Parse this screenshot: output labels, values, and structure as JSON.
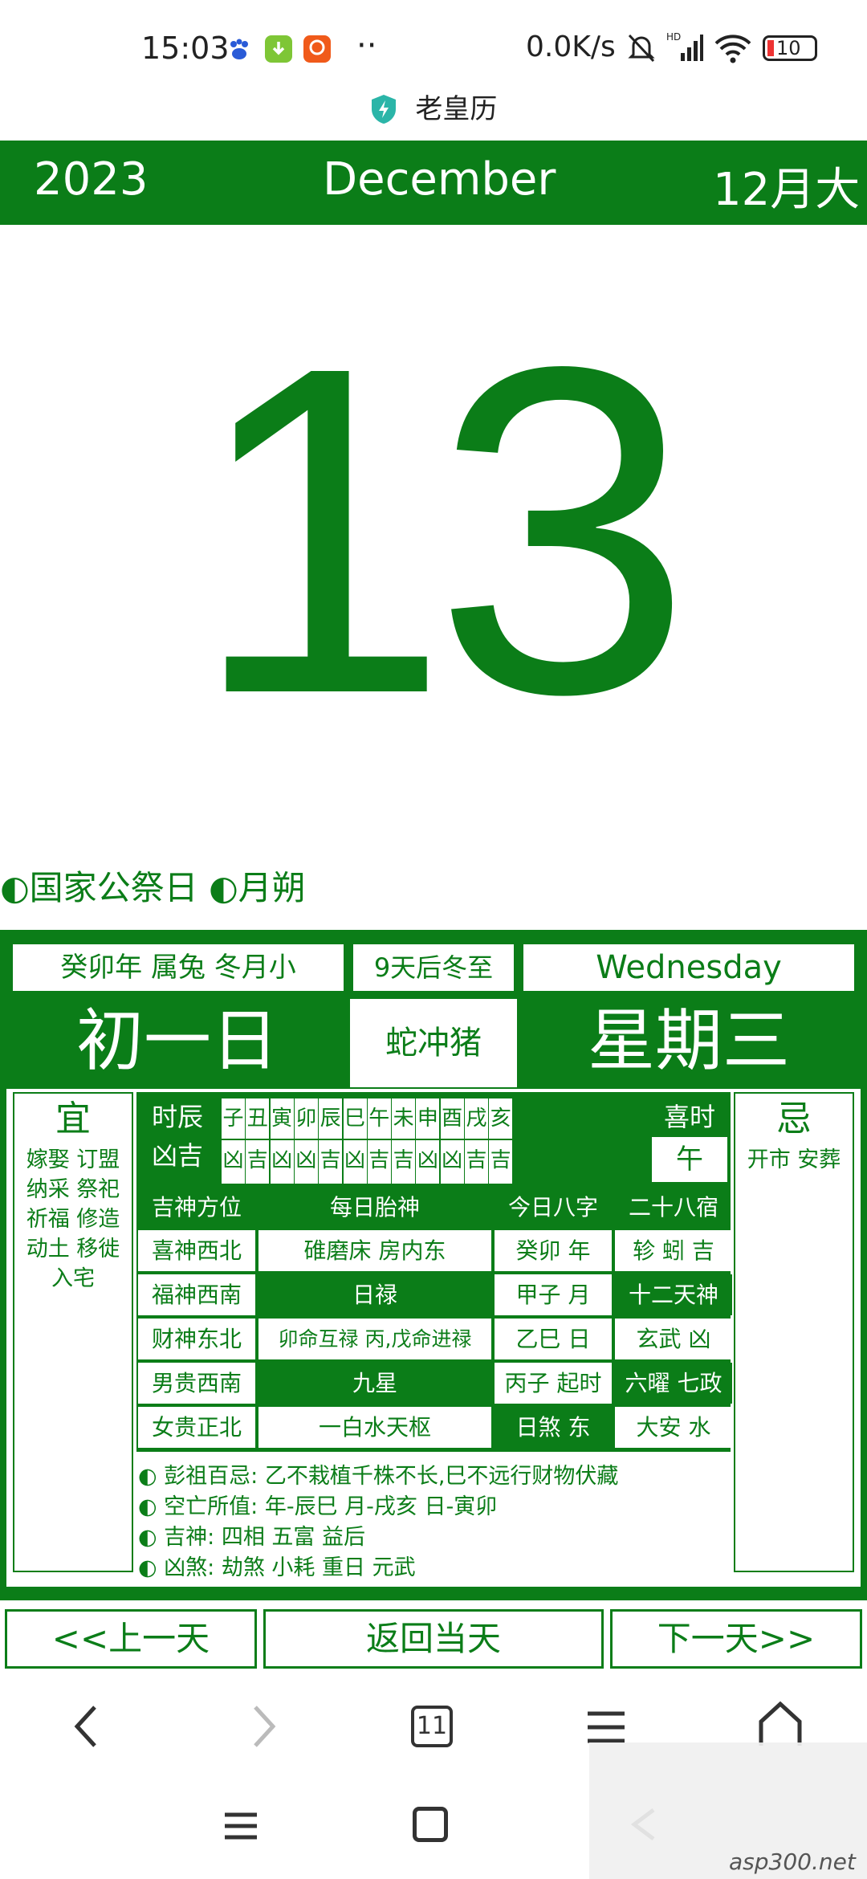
{
  "status_bar": {
    "time": "15:03",
    "dots": "··",
    "speed": "0.0K/s",
    "battery": "10"
  },
  "app_title": "老皇历",
  "header": {
    "year": "2023",
    "month_en": "December",
    "month_cn": "12月大"
  },
  "day_number": "13",
  "festivals": "◐国家公祭日 ◐月朔",
  "panel": {
    "year_info": "癸卯年 属兔 冬月小",
    "countdown": "9天后冬至",
    "weekday_en": "Wednesday",
    "lunar_day": "初一日",
    "conflict": "蛇冲猪",
    "weekday_cn": "星期三",
    "yi_title": "宜",
    "yi_items": [
      "嫁娶 订盟",
      "纳采 祭祀",
      "祈福 修造",
      "动土 移徙",
      "入宅"
    ],
    "ji_title": "忌",
    "ji_items": [
      "开市 安葬"
    ],
    "shichen_label": "时辰",
    "xiongji_label": "凶吉",
    "hours": [
      "子",
      "丑",
      "寅",
      "卯",
      "辰",
      "巳",
      "午",
      "未",
      "申",
      "酉",
      "戌",
      "亥"
    ],
    "hour_luck": [
      "凶",
      "吉",
      "凶",
      "凶",
      "吉",
      "凶",
      "吉",
      "吉",
      "凶",
      "凶",
      "吉",
      "吉"
    ],
    "xishi_label": "喜时",
    "xishi_value": "午",
    "col_headers": [
      "吉神方位",
      "每日胎神",
      "今日八字",
      "二十八宿"
    ],
    "directions": [
      "喜神西北",
      "福神西南",
      "财神东北",
      "男贵西南",
      "女贵正北"
    ],
    "taishen": [
      "碓磨床 房内东",
      "日禄",
      "卯命互禄 丙,戊命进禄",
      "九星",
      "一白水天枢"
    ],
    "bazi": [
      "癸卯 年",
      "甲子 月",
      "乙巳 日",
      "丙子 起时",
      "日煞 东"
    ],
    "xiu": [
      "轸 蚓 吉",
      "十二天神",
      "玄武 凶",
      "六曜 七政",
      "大安 水"
    ],
    "notes": [
      "◐ 彭祖百忌: 乙不栽植千株不长,巳不远行财物伏藏",
      "◐ 空亡所值: 年-辰巳 月-戌亥 日-寅卯",
      "◐ 吉神: 四相 五富 益后",
      "◐ 凶煞: 劫煞 小耗 重日 元武"
    ]
  },
  "nav": {
    "prev": "<<上一天",
    "today": "返回当天",
    "next": "下一天>>"
  },
  "browser": {
    "tabs_count": "11"
  },
  "watermark": "asp300.net",
  "colors": {
    "accent": "#0b7d18"
  }
}
